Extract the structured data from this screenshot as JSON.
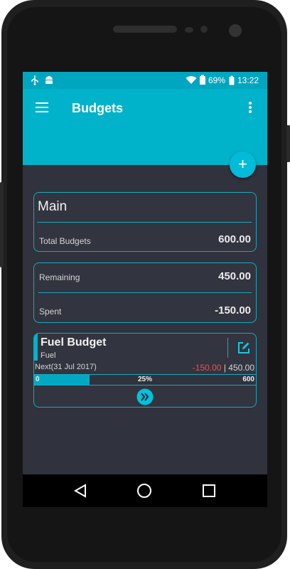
{
  "status": {
    "battery": "69%",
    "time": "13:22"
  },
  "appbar": {
    "title": "Budgets"
  },
  "fab": {
    "label": "+"
  },
  "main_card": {
    "title": "Main",
    "total_label": "Total Budgets",
    "total_value": "600.00"
  },
  "summary": {
    "remaining_label": "Remaining",
    "remaining_value": "450.00",
    "spent_label": "Spent",
    "spent_value": "-150.00"
  },
  "budget_item": {
    "name": "Fuel Budget",
    "category": "Fuel",
    "next": "Next(31 Jul 2017)",
    "spent": "-150.00",
    "separator": "|",
    "remaining": "450.00",
    "progress_start": "0",
    "progress_percent_label": "25%",
    "progress_end": "600",
    "progress_fraction": 0.25
  },
  "colors": {
    "accent": "#00b3ca",
    "bar": "#00a9c3",
    "negative": "#f05050",
    "background": "#30323d"
  }
}
